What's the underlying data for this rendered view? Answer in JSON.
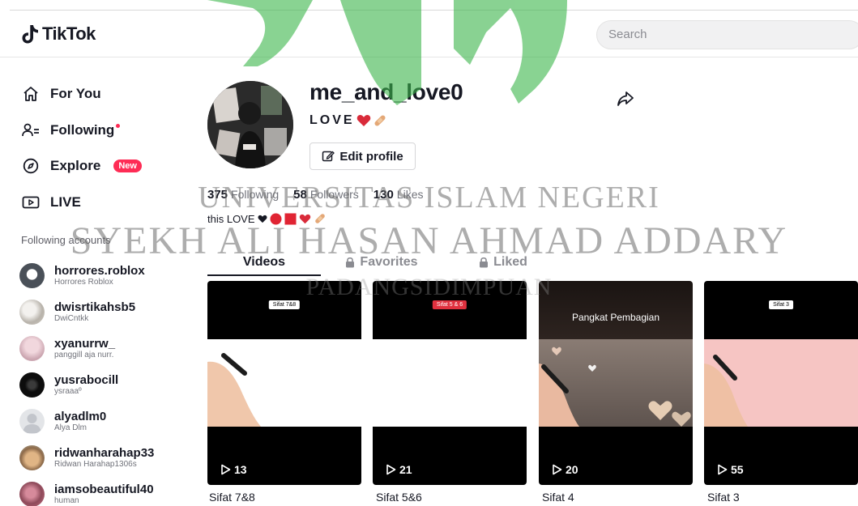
{
  "header": {
    "logo_text": "TikTok",
    "search_placeholder": "Search"
  },
  "sidebar": {
    "nav": [
      {
        "label": "For You",
        "icon": "home-icon"
      },
      {
        "label": "Following",
        "icon": "following-icon",
        "has_dot": true
      },
      {
        "label": "Explore",
        "icon": "compass-icon",
        "badge": "New"
      },
      {
        "label": "LIVE",
        "icon": "live-icon"
      }
    ],
    "following_title": "Following accounts",
    "accounts": [
      {
        "username": "horrores.roblox",
        "nickname": "Horrores Roblox"
      },
      {
        "username": "dwisrtikahsb5",
        "nickname": "DwiCntkk"
      },
      {
        "username": "xyanurrw_",
        "nickname": "panggill aja nurr."
      },
      {
        "username": "yusrabocill",
        "nickname": "ysraaaº"
      },
      {
        "username": "alyadlm0",
        "nickname": "Alya Dlm"
      },
      {
        "username": "ridwanharahap33",
        "nickname": "Ridwan Harahap1306s"
      },
      {
        "username": "iamsobeautiful40",
        "nickname": "human"
      }
    ]
  },
  "profile": {
    "username": "me_and_love0",
    "nickname": "LOVE",
    "edit_label": "Edit profile",
    "stats": {
      "following_count": "375",
      "following_label": "Following",
      "followers_count": "58",
      "followers_label": "Followers",
      "likes_count": "130",
      "likes_label": "Likes"
    },
    "bio": "this LOVE"
  },
  "tabs": [
    {
      "label": "Videos",
      "active": true
    },
    {
      "label": "Favorites",
      "locked": true
    },
    {
      "label": "Liked",
      "locked": true
    }
  ],
  "videos": [
    {
      "badge": "Sifat 7&8",
      "badge_style": "white",
      "views": "13",
      "caption": "Sifat 7&8",
      "mid_color": "#ffffff"
    },
    {
      "badge": "Sifat 5 & 6",
      "badge_style": "red",
      "views": "21",
      "caption": "Sifat 5&6",
      "mid_color": "#ffffff"
    },
    {
      "heading": "Pangkat Pembagian",
      "views": "20",
      "caption": "Sifat 4",
      "mid_color": "#6f6561"
    },
    {
      "badge": "Sifat 3",
      "badge_style": "white",
      "views": "55",
      "caption": "Sifat 3",
      "mid_color": "#f6c5c3"
    }
  ],
  "watermark": {
    "line1": "UNIVERSITAS ISLAM NEGERI",
    "line2": "SYEKH ALI HASAN AHMAD ADDARY",
    "line3": "PADANGSIDIMPUAN",
    "color": "#3bb54a"
  },
  "colors": {
    "accent": "#fe2c55",
    "text": "#161823",
    "muted": "#70727a"
  }
}
